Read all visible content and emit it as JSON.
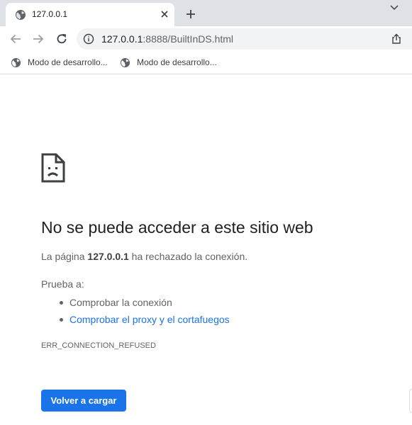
{
  "tab": {
    "title": "127.0.0.1"
  },
  "toolbar": {
    "url_host": "127.0.0.1",
    "url_rest": ":8888/BuiltInDS.html"
  },
  "bookmarks": [
    {
      "label": "Modo de desarrollo..."
    },
    {
      "label": "Modo de desarrollo..."
    }
  ],
  "error": {
    "heading": "No se puede acceder a este sitio web",
    "message_prefix": "La página ",
    "message_host": "127.0.0.1",
    "message_suffix": " ha rechazado la conexión.",
    "try_label": "Prueba a:",
    "suggestions": [
      {
        "text": "Comprobar la conexión"
      },
      {
        "text": "Comprobar el proxy y el cortafuegos"
      }
    ],
    "code": "ERR_CONNECTION_REFUSED",
    "reload_label": "Volver a cargar"
  },
  "colors": {
    "accent": "#1a73e8",
    "tabstrip": "#dee1e6",
    "omnibox": "#f1f3f4"
  }
}
